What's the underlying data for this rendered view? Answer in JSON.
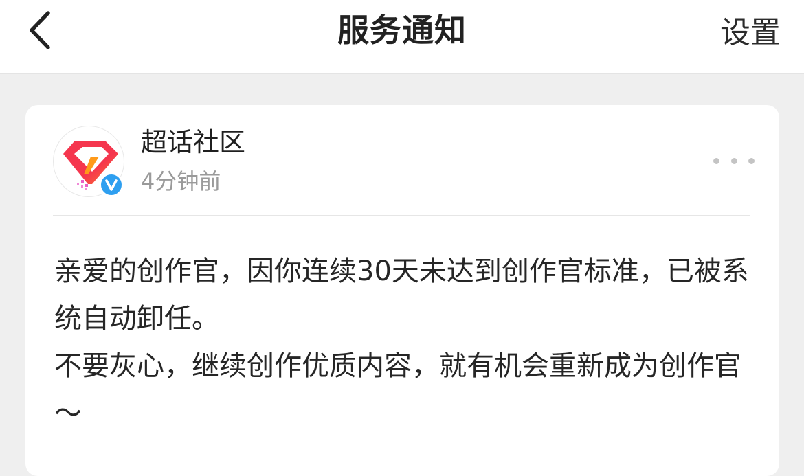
{
  "header": {
    "title": "服务通知",
    "settings_label": "设置"
  },
  "notification": {
    "sender": "超话社区",
    "timestamp": "4分钟前",
    "body": [
      "亲爱的创作官，因你连续30天未达到创作官标准，已被系统自动卸任。",
      "不要灰心，继续创作优质内容，就有机会重新成为创作官～"
    ]
  },
  "icons": {
    "back": "chevron-left-icon",
    "avatar_logo": "diamond-logo",
    "verified": "verified-v-icon",
    "more": "more-dots-icon"
  },
  "colors": {
    "page_background": "#efefef",
    "card_background": "#ffffff",
    "timestamp_gray": "#9a9a9a",
    "verified_blue": "#2e9ff0",
    "logo_red": "#f5364e",
    "logo_orange": "#ff9a1a"
  }
}
